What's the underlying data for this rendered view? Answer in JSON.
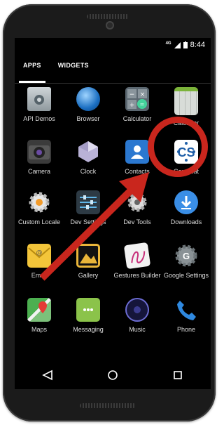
{
  "status": {
    "network": "4G",
    "time": "8:44"
  },
  "tabs": [
    {
      "label": "APPS",
      "active": true
    },
    {
      "label": "WIDGETS",
      "active": false
    }
  ],
  "apps": [
    {
      "name": "API Demos",
      "icon": "folder-gear-icon"
    },
    {
      "name": "Browser",
      "icon": "globe-icon"
    },
    {
      "name": "Calculator",
      "icon": "calculator-icon"
    },
    {
      "name": "Calendar",
      "icon": "calendar-icon"
    },
    {
      "name": "Camera",
      "icon": "camera-icon"
    },
    {
      "name": "Clock",
      "icon": "clock-icon"
    },
    {
      "name": "Contacts",
      "icon": "contacts-icon"
    },
    {
      "name": "Contasat",
      "icon": "contasat-cs-icon",
      "logo_text": "CS"
    },
    {
      "name": "Custom Locale",
      "icon": "gear-icon"
    },
    {
      "name": "Dev Settings",
      "icon": "sliders-icon"
    },
    {
      "name": "Dev Tools",
      "icon": "tools-gear-icon"
    },
    {
      "name": "Downloads",
      "icon": "download-icon"
    },
    {
      "name": "Email",
      "icon": "email-icon"
    },
    {
      "name": "Gallery",
      "icon": "gallery-icon"
    },
    {
      "name": "Gestures Builder",
      "icon": "gestures-icon"
    },
    {
      "name": "Google Settings",
      "icon": "google-settings-icon"
    },
    {
      "name": "Maps",
      "icon": "maps-icon"
    },
    {
      "name": "Messaging",
      "icon": "messaging-icon"
    },
    {
      "name": "Music",
      "icon": "music-icon"
    },
    {
      "name": "Phone",
      "icon": "phone-icon"
    }
  ],
  "nav": {
    "back": "back-icon",
    "home": "home-icon",
    "recents": "recents-icon"
  },
  "colors": {
    "annotation": "#c9261d",
    "contasat_blue": "#1f5fa8"
  }
}
